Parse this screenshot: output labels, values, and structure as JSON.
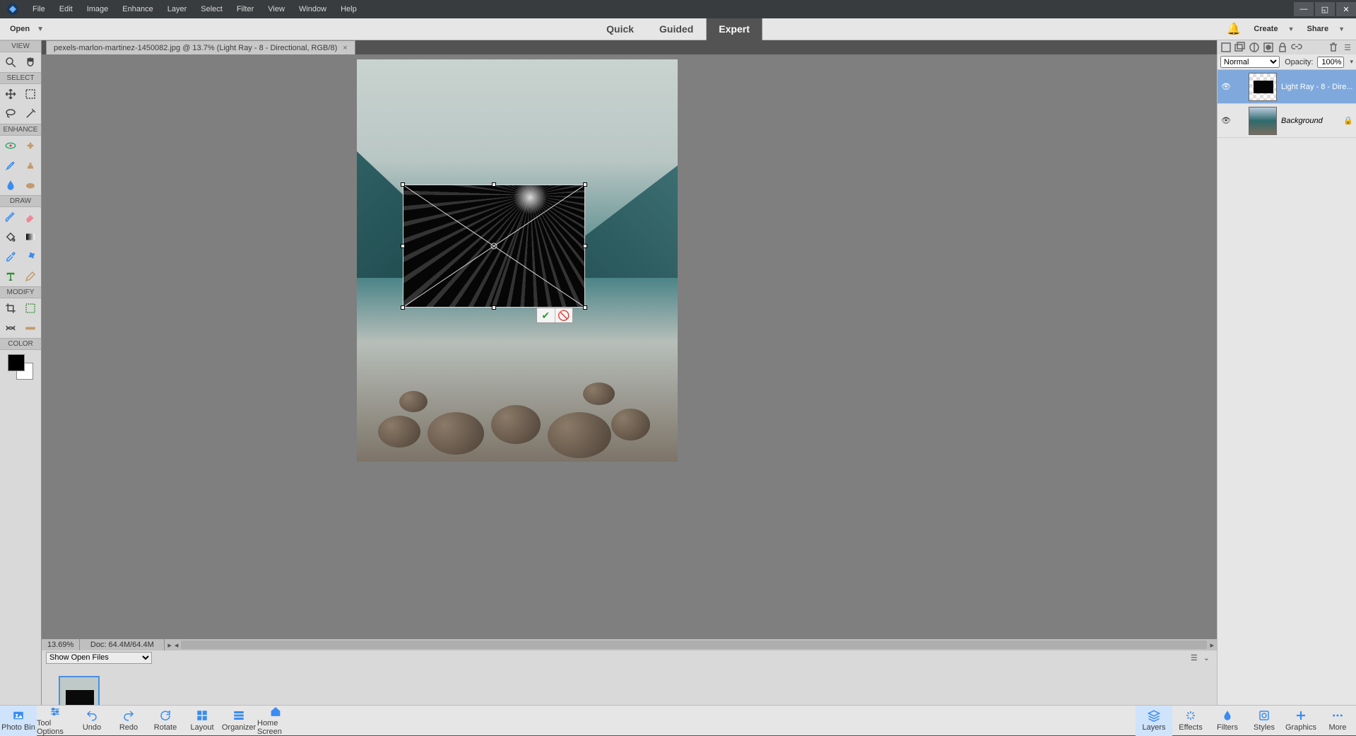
{
  "menu": {
    "items": [
      "File",
      "Edit",
      "Image",
      "Enhance",
      "Layer",
      "Select",
      "Filter",
      "View",
      "Window",
      "Help"
    ]
  },
  "modebar": {
    "open": "Open",
    "modes": [
      "Quick",
      "Guided",
      "Expert"
    ],
    "active": "Expert",
    "create": "Create",
    "share": "Share"
  },
  "doc": {
    "tab": "pexels-marlon-martinez-1450082.jpg @ 13.7% (Light Ray - 8 - Directional, RGB/8)"
  },
  "toolbox": {
    "sections": [
      "VIEW",
      "SELECT",
      "ENHANCE",
      "DRAW",
      "MODIFY",
      "COLOR"
    ]
  },
  "status": {
    "zoom": "13.69%",
    "docinfo": "Doc: 64.4M/64.4M"
  },
  "openfiles": {
    "label": "Show Open Files"
  },
  "taskbar": {
    "left": [
      "Photo Bin",
      "Tool Options",
      "Undo",
      "Redo",
      "Rotate",
      "Layout",
      "Organizer",
      "Home Screen"
    ],
    "right": [
      "Layers",
      "Effects",
      "Filters",
      "Styles",
      "Graphics",
      "More"
    ]
  },
  "layers": {
    "blendmode": "Normal",
    "opacity_label": "Opacity:",
    "opacity_value": "100%",
    "items": [
      {
        "name": "Light Ray - 8 - Dire...",
        "selected": true
      },
      {
        "name": "Background",
        "selected": false,
        "locked": true
      }
    ]
  }
}
